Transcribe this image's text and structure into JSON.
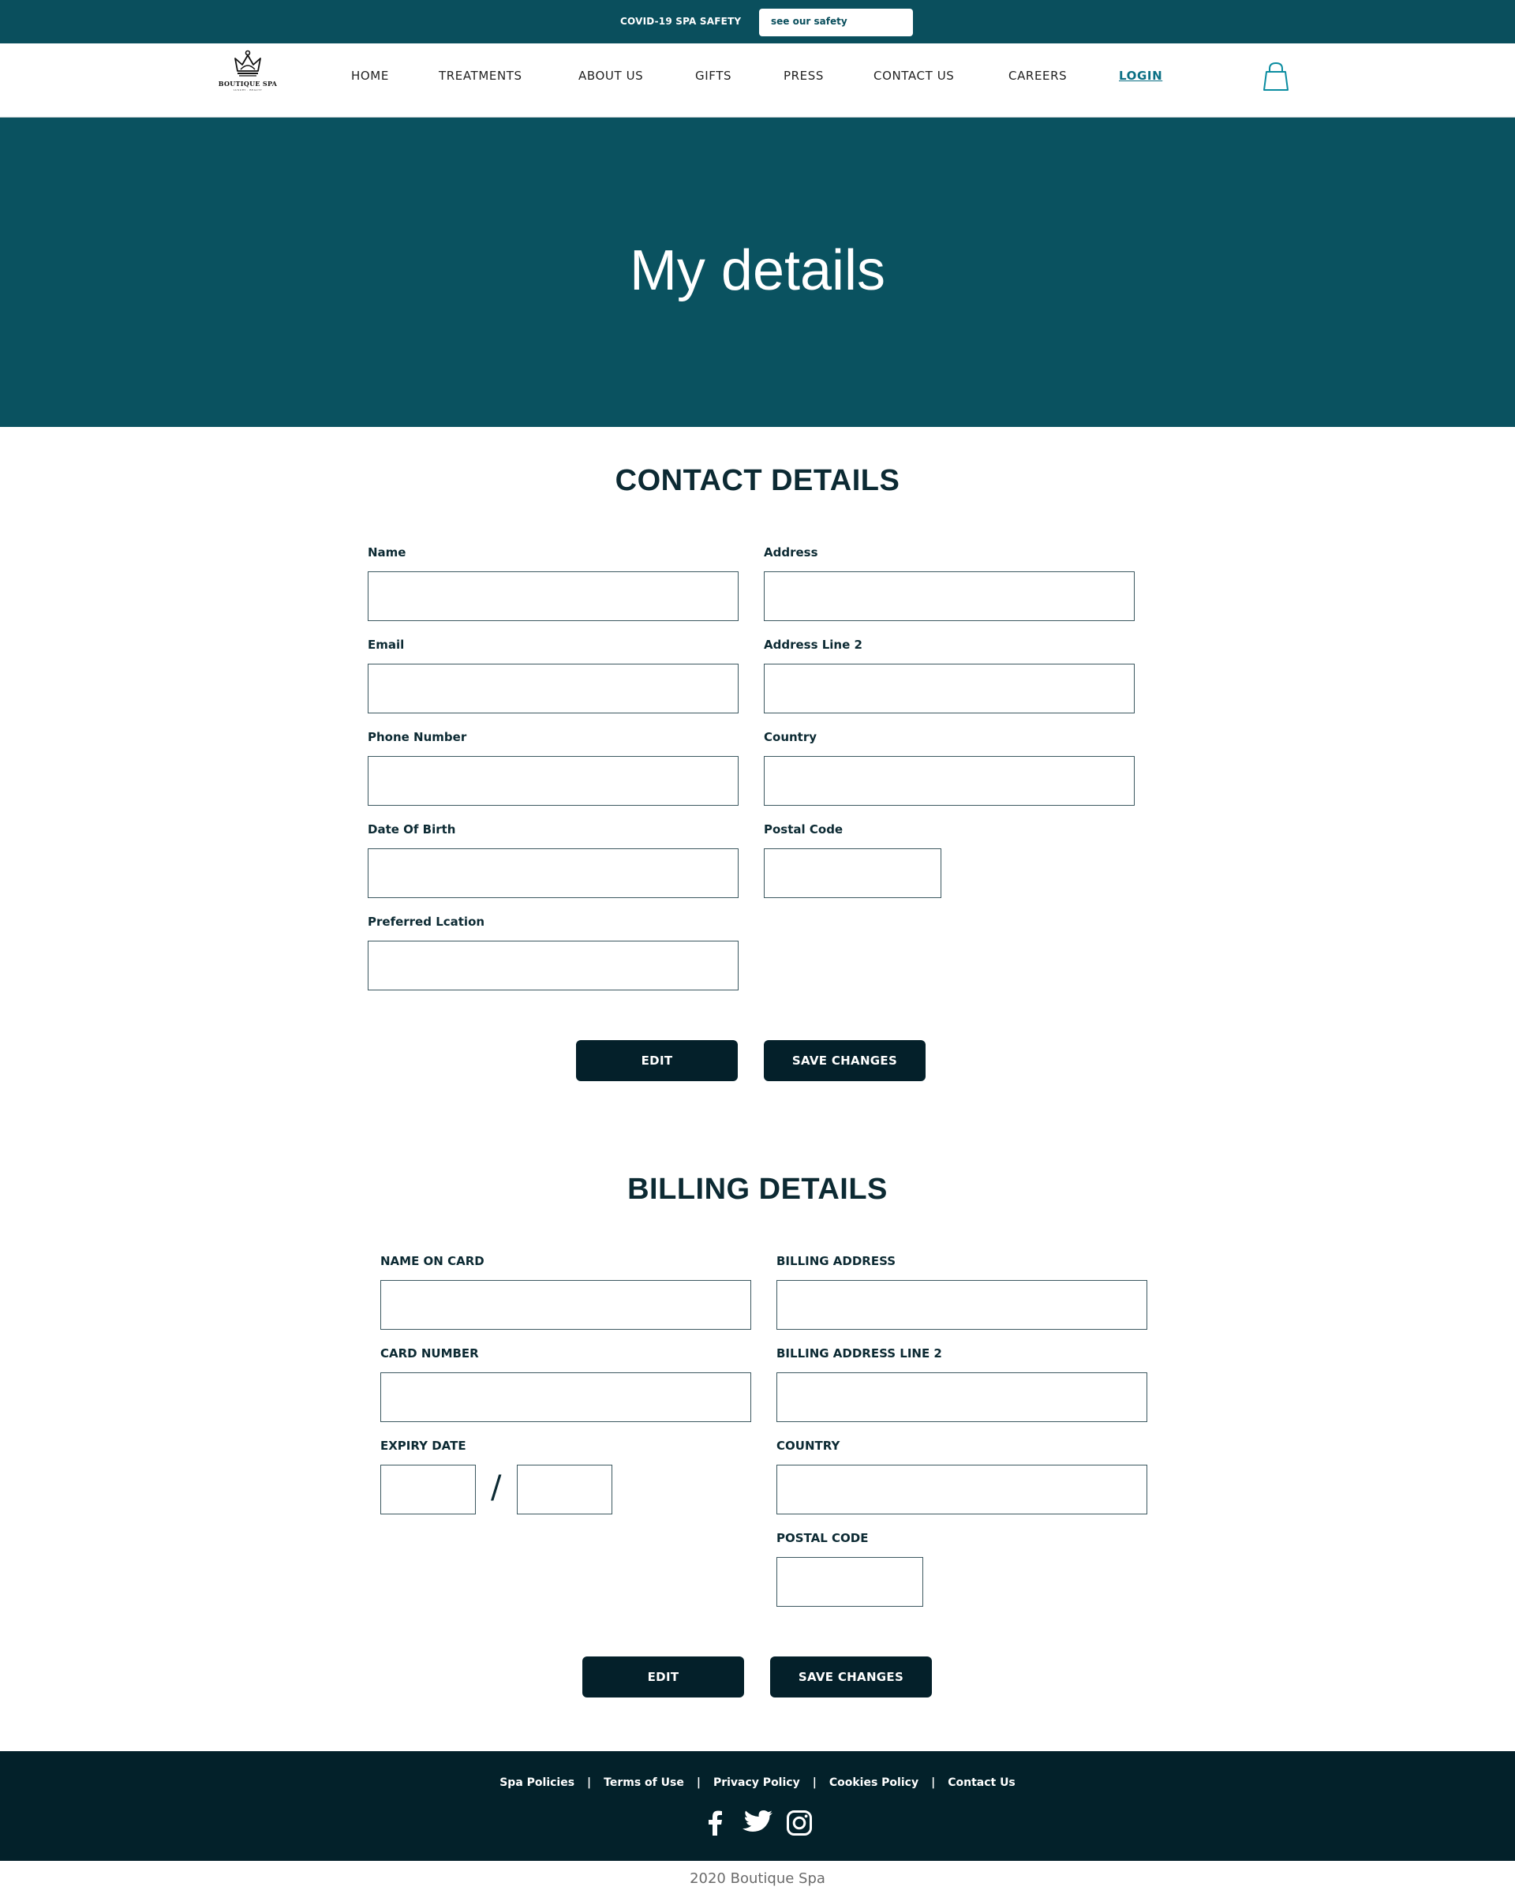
{
  "announcement": {
    "text": "COVID-19 SPA SAFETY",
    "button_label": "see our safety"
  },
  "logo": {
    "name": "BOUTIQUE SPA",
    "tagline": "LUXURY · BEAUTY"
  },
  "nav": {
    "items": [
      "HOME",
      "TREATMENTS",
      "ABOUT US",
      "GIFTS",
      "PRESS",
      "CONTACT US",
      "CAREERS"
    ],
    "login": "LOGIN"
  },
  "hero": {
    "title": "My details"
  },
  "contact": {
    "title": "CONTACT DETAILS",
    "labels": {
      "name": "Name",
      "address": "Address",
      "email": "Email",
      "address2": "Address Line 2",
      "phone": "Phone Number",
      "country": "Country",
      "dob": "Date Of Birth",
      "postal": "Postal Code",
      "location": "Preferred Lcation"
    },
    "edit_label": "EDIT",
    "save_label": "SAVE CHANGES"
  },
  "billing": {
    "title": "BILLING DETAILS",
    "labels": {
      "name_on_card": "NAME ON CARD",
      "billing_address": "BILLING ADDRESS",
      "card_number": "CARD NUMBER",
      "billing_address2": "BILLING ADDRESS LINE 2",
      "expiry": "EXPIRY DATE",
      "country": "COUNTRY",
      "postal": "POSTAL CODE"
    },
    "expiry_separator": "/",
    "edit_label": "EDIT",
    "save_label": "SAVE CHANGES"
  },
  "footer": {
    "links": [
      "Spa Policies",
      "Terms of Use",
      "Privacy Policy",
      "Cookies Policy",
      "Contact Us"
    ],
    "separator": "|",
    "social": [
      "facebook-icon",
      "twitter-icon",
      "instagram-icon"
    ],
    "copyright": "2020 Boutique Spa"
  },
  "colors": {
    "announcement_bg": "#0a4f5d",
    "hero_bg": "#0a5260",
    "footer_bg": "#03212a",
    "button_bg": "#04202a",
    "login_link": "#0a6f84"
  }
}
